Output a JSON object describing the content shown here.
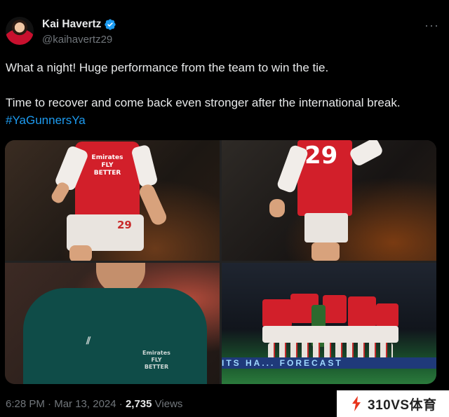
{
  "author": {
    "display_name": "Kai Havertz",
    "handle": "@kaihavertz29",
    "verified_icon": "verified-badge-icon",
    "verified_color": "#1d9bf0"
  },
  "more_label": "···",
  "tweet": {
    "line1": "What a night! Huge performance from the team to win the tie.",
    "line2_text": "Time to recover and come back even stronger after the international break. ",
    "hashtag": "#YaGunnersYa",
    "hashtag_color": "#1d9bf0"
  },
  "media": {
    "photo1": {
      "shirt_text": "Emirates FLY BETTER",
      "shorts_number": "29"
    },
    "photo2": {
      "shirt_number": "29"
    },
    "photo3": {
      "jacket_text": "Emirates FLY BETTER"
    },
    "photo4": {
      "board_text": "ITS HA... FORECAST"
    }
  },
  "meta": {
    "time": "6:28 PM",
    "separator": "·",
    "date": "Mar 13, 2024",
    "views_count": "2,735",
    "views_label": "Views"
  },
  "watermark": {
    "text": "310VS体育",
    "logo_icon": "flame-s-logo-icon",
    "logo_color": "#e8351d"
  }
}
